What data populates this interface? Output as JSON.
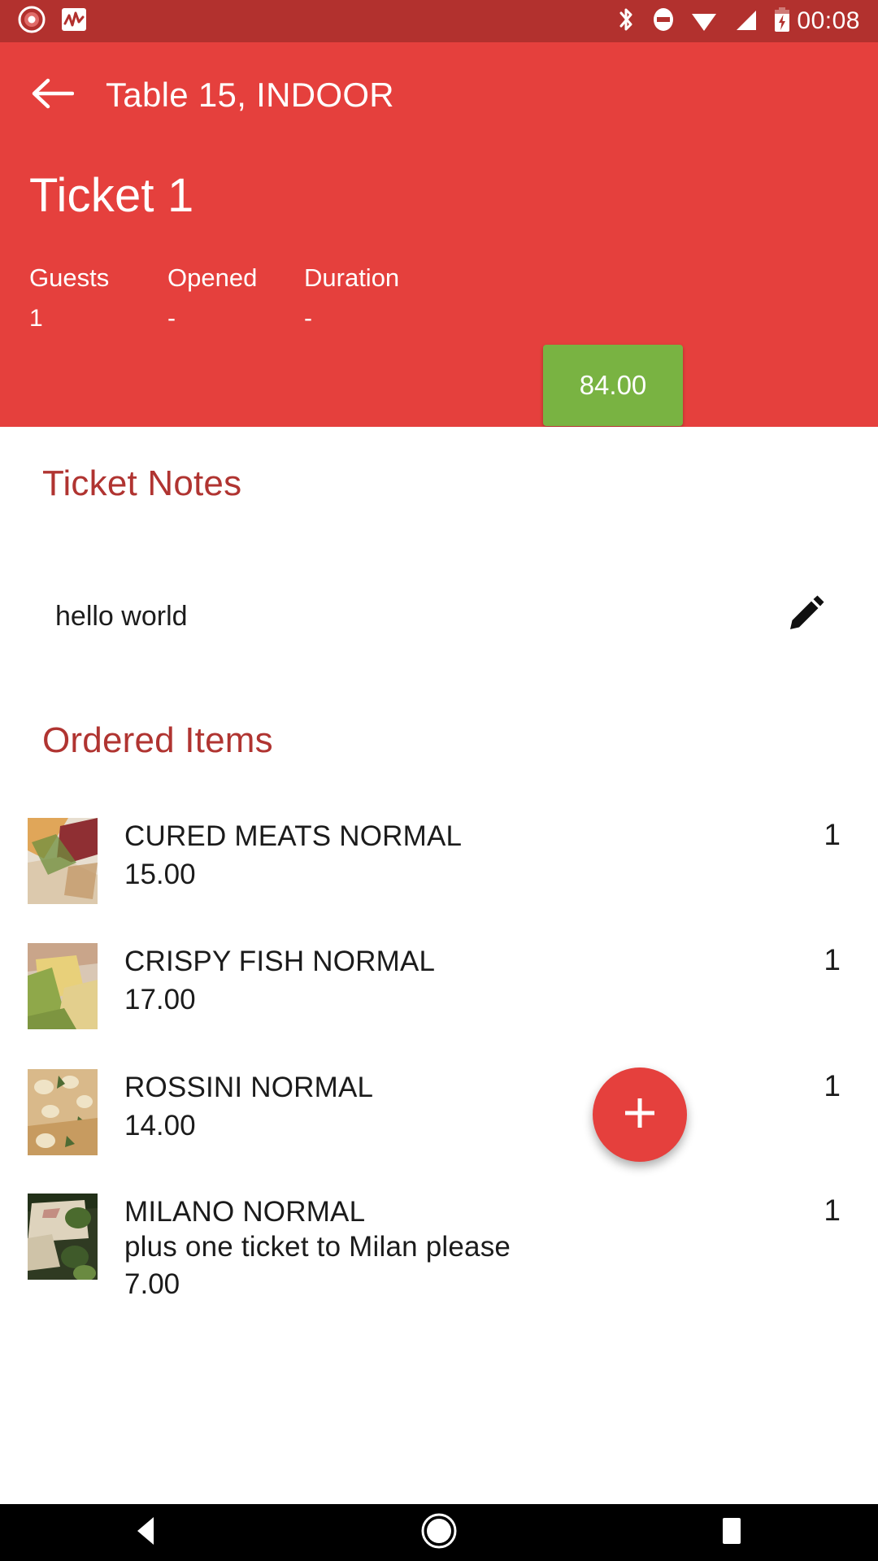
{
  "status_bar": {
    "clock": "00:08",
    "left_icons": [
      "record-icon",
      "activity-graph-icon"
    ],
    "right_icons": [
      "bluetooth-icon",
      "do-not-disturb-icon",
      "wifi-icon",
      "cellular-signal-icon",
      "battery-charging-icon"
    ],
    "background_color": "#b2312e"
  },
  "header": {
    "background_color": "#e5403d",
    "back_label": "back-arrow",
    "title": "Table 15, INDOOR",
    "ticket_name": "Ticket 1",
    "stats": [
      {
        "label": "Guests",
        "value": "1"
      },
      {
        "label": "Opened",
        "value": "-"
      },
      {
        "label": "Duration",
        "value": "-"
      }
    ],
    "total": {
      "amount": "84.00",
      "color": "#79b342"
    }
  },
  "notes_section": {
    "title": "Ticket Notes",
    "note_text": "hello world",
    "edit_icon": "pencil-icon",
    "heading_color": "#b03431"
  },
  "items_section": {
    "title": "Ordered Items",
    "items": [
      {
        "name": "CURED MEATS NORMAL",
        "note": "",
        "price": "15.00",
        "qty": "1",
        "thumb_colors": [
          "#d8c49a",
          "#8f2f33",
          "#6f8f3f"
        ]
      },
      {
        "name": "CRISPY FISH NORMAL",
        "note": "",
        "price": "17.00",
        "qty": "1",
        "thumb_colors": [
          "#e8d07a",
          "#8fa84a",
          "#c9a58a"
        ]
      },
      {
        "name": "ROSSINI NORMAL",
        "note": "",
        "price": "14.00",
        "qty": "1",
        "thumb_colors": [
          "#d9b98a",
          "#e8dcc0",
          "#4e6b33"
        ]
      },
      {
        "name": "MILANO NORMAL",
        "note": "plus one ticket to Milan please",
        "price": "7.00",
        "qty": "1",
        "thumb_colors": [
          "#ccc6b4",
          "#3f5a2a",
          "#b8a48f"
        ]
      }
    ]
  },
  "fab": {
    "icon": "plus-icon",
    "color": "#e5403d"
  },
  "nav_bar": {
    "buttons": [
      "back-triangle-icon",
      "home-circle-icon",
      "recents-square-icon"
    ],
    "background_color": "#000000"
  }
}
